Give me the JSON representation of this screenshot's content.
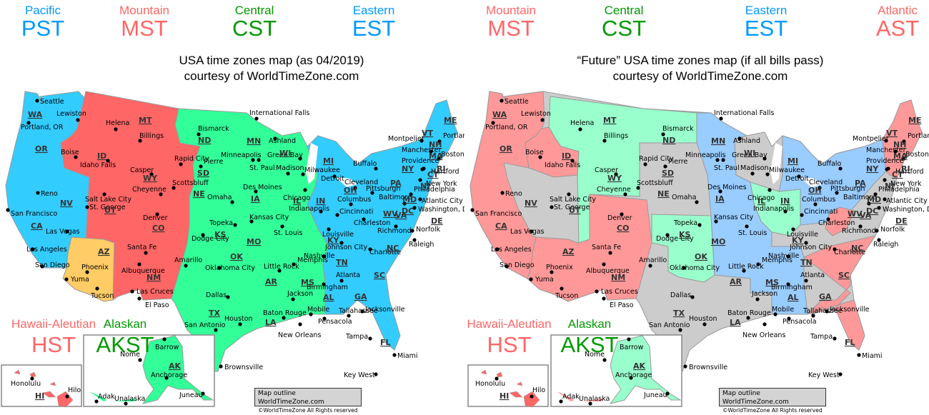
{
  "colors": {
    "pacific": "#33ccff",
    "mountain": "#ff6666",
    "central": "#33ff99",
    "eastern": "#33ccff",
    "arizona_mst": "#ffcc66",
    "future_mountain": "#ff9999",
    "future_central": "#99ffcc",
    "future_eastern": "#99ccff",
    "future_atlantic": "#ff9999",
    "future_gray": "#cccccc",
    "hawaii": "#ff6666",
    "alaska_left": "#33ff99",
    "alaska_right": "#99ffcc",
    "label_pacific": "#0099ff",
    "label_mountain": "#ff6666",
    "label_central": "#009900",
    "label_eastern": "#0099ff",
    "label_atlantic": "#ff6666"
  },
  "left": {
    "title_line1": "USA time zones map (as 04/2019)",
    "title_line2": "courtesy of WorldTimeZone.com",
    "zones": [
      {
        "name": "Pacific",
        "abbr": "PST"
      },
      {
        "name": "Mountain",
        "abbr": "MST"
      },
      {
        "name": "Central",
        "abbr": "CST"
      },
      {
        "name": "Eastern",
        "abbr": "EST"
      }
    ],
    "hawaii": {
      "name": "Hawaii-Aleutian",
      "abbr": "HST"
    },
    "alaska": {
      "name": "Alaskan",
      "abbr": "AKST"
    },
    "credit_line1": "Map outline WorldTimeZone.com",
    "credit_line2": "©WorldTimeZone  All Rights reserved"
  },
  "right": {
    "title_line1": "“Future” USA time zones map (if all bills pass)",
    "title_line2": "courtesy of WorldTimeZone.com",
    "zones": [
      {
        "name": "Mountain",
        "abbr": "MST"
      },
      {
        "name": "Central",
        "abbr": "CST"
      },
      {
        "name": "Eastern",
        "abbr": "EST"
      },
      {
        "name": "Atlantic",
        "abbr": "AST"
      }
    ],
    "hawaii": {
      "name": "Hawaii-Aleutian",
      "abbr": "HST"
    },
    "alaska": {
      "name": "Alaskan",
      "abbr": "AKST"
    },
    "credit_line1": "Map outline WorldTimeZone.com",
    "credit_line2": "©WorldTimeZone  All Rights reserved"
  },
  "states": [
    "WA",
    "OR",
    "CA",
    "NV",
    "ID",
    "MT",
    "WY",
    "UT",
    "CO",
    "AZ",
    "NM",
    "ND",
    "SD",
    "NE",
    "KS",
    "OK",
    "TX",
    "MN",
    "IA",
    "MO",
    "AR",
    "LA",
    "WI",
    "IL",
    "MS",
    "AL",
    "TN",
    "KY",
    "IN",
    "MI",
    "OH",
    "GA",
    "FL",
    "SC",
    "NC",
    "VA",
    "WV",
    "PA",
    "NY",
    "VT",
    "NH",
    "ME",
    "MA",
    "RI",
    "CT",
    "NJ",
    "DE",
    "MD",
    "DC",
    "AK",
    "HI"
  ],
  "cities": [
    "Seattle",
    "Lewiston",
    "Portland, OR",
    "Boise",
    "Idaho Falls",
    "Helena",
    "Billings",
    "Reno",
    "San Francisco",
    "Las Vegas",
    "Los Angeles",
    "San Diego",
    "Phoenix",
    "Yuma",
    "Tucson",
    "Salt Lake City",
    "St. George",
    "Casper",
    "Cheyenne",
    "Denver",
    "Santa Fe",
    "Albuquerque",
    "Las Cruces",
    "El Paso",
    "Bismarck",
    "Rapid City",
    "Pierre",
    "Scottsbluff",
    "Omaha",
    "Topeka",
    "Dodge City",
    "Amarillo",
    "Oklahoma City",
    "Dallas",
    "San Antonio",
    "Houston",
    "Brownsville",
    "International Falls",
    "Minneapolis",
    "St. Paul",
    "Des Moines",
    "Kansas City",
    "St. Louis",
    "Little Rock",
    "Baton Rouge",
    "New Orleans",
    "Jackson",
    "Memphis",
    "Nashville",
    "Ashland",
    "Green Bay",
    "Madison",
    "Milwaukee",
    "Chicago",
    "Indianapolis",
    "Detroit",
    "Louisville",
    "Cincinnati",
    "Columbus",
    "Cleveland",
    "Buffalo",
    "Pittsburgh",
    "Charleston",
    "Richmond",
    "Baltimore",
    "Washington, DC",
    "Philadelphia",
    "Atlantic City",
    "New York",
    "Norfolk",
    "Hartford",
    "Providence",
    "Boston",
    "Manchester",
    "Montpelier",
    "Portland, ME",
    "Johnson City",
    "Raleigh",
    "Charlotte",
    "Atlanta",
    "Birmingham",
    "Mobile",
    "Pensacola",
    "Tallahassee",
    "Jacksonville",
    "Tampa",
    "Miami",
    "Key West",
    "Nome",
    "Barrow",
    "Anchorage",
    "Adak",
    "Unalaska",
    "Juneau",
    "Honolulu",
    "Hilo"
  ]
}
